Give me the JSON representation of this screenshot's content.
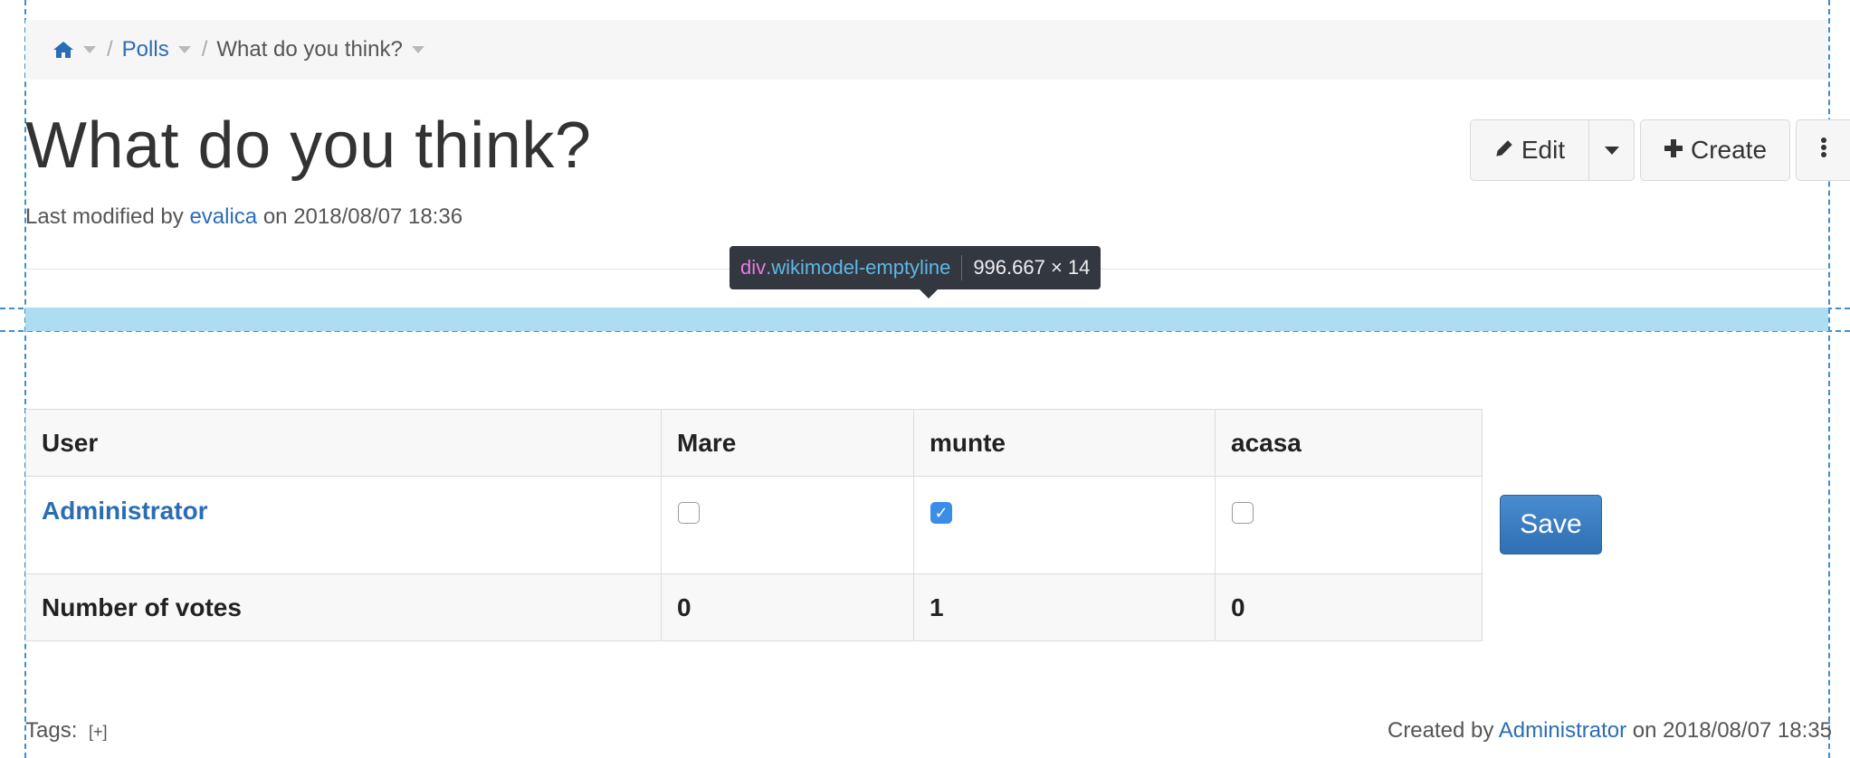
{
  "breadcrumb": {
    "home_icon": "home-icon",
    "items": [
      {
        "label": "Polls"
      },
      {
        "label": "What do you think?"
      }
    ],
    "separator": "/"
  },
  "page": {
    "title": "What do you think?",
    "modified_prefix": "Last modified by",
    "modified_user": "evalica",
    "modified_on": "on 2018/08/07 18:36"
  },
  "actions": {
    "edit_label": "Edit",
    "edit_icon": "pencil-icon",
    "create_label": "Create",
    "create_icon": "plus-icon",
    "more_icon": "vertical-dots-icon"
  },
  "devtools_tooltip": {
    "tag": "div",
    "class": ".wikimodel-emptyline",
    "size": "996.667 × 14"
  },
  "poll": {
    "headers": [
      "User",
      "Mare",
      "munte",
      "acasa"
    ],
    "rows": [
      {
        "user": "Administrator",
        "votes": [
          false,
          true,
          false
        ]
      }
    ],
    "totals_label": "Number of votes",
    "totals": [
      "0",
      "1",
      "0"
    ],
    "save_label": "Save"
  },
  "footer": {
    "tags_label": "Tags:",
    "tags_add": "[+]",
    "created_prefix": "Created by",
    "created_user": "Administrator",
    "created_on": "on 2018/08/07 18:35"
  },
  "colors": {
    "link": "#2a6db5",
    "highlight": "#aedcf1",
    "tooltip_bg": "#333740",
    "checkbox_checked": "#3b8ee8"
  }
}
